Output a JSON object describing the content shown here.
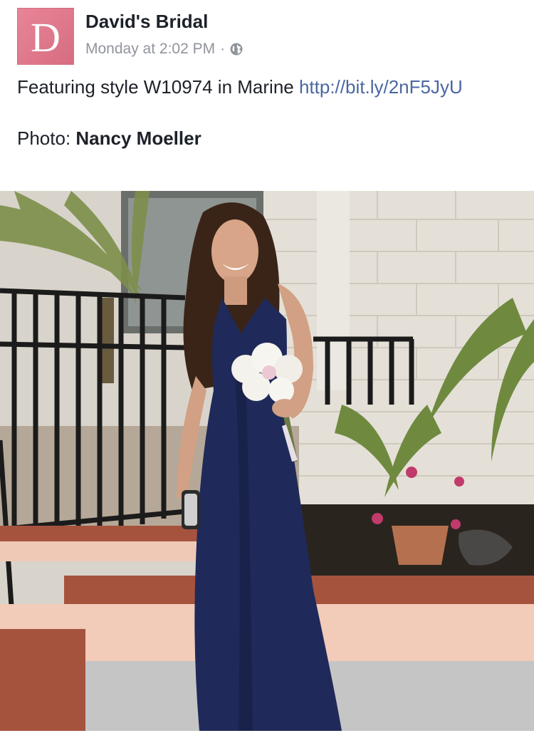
{
  "post": {
    "author": "David's Bridal",
    "avatar_letter": "D",
    "timestamp": "Monday at 2:02 PM",
    "separator": "·",
    "privacy_icon": "globe-icon",
    "text_line1_prefix": "Featuring style W10974 in Marine ",
    "link_text": "http://bit.ly/2nF5JyU",
    "credit_label": "Photo: ",
    "credit_name": "Nancy Moeller"
  },
  "colors": {
    "brand_pink": "#e98597",
    "link_blue": "#4b67a1",
    "meta_gray": "#90949c",
    "text_dark": "#1d2129",
    "dress_navy": "#1f2a5a"
  },
  "photo": {
    "description_icon": "bridesmaid-photo"
  }
}
